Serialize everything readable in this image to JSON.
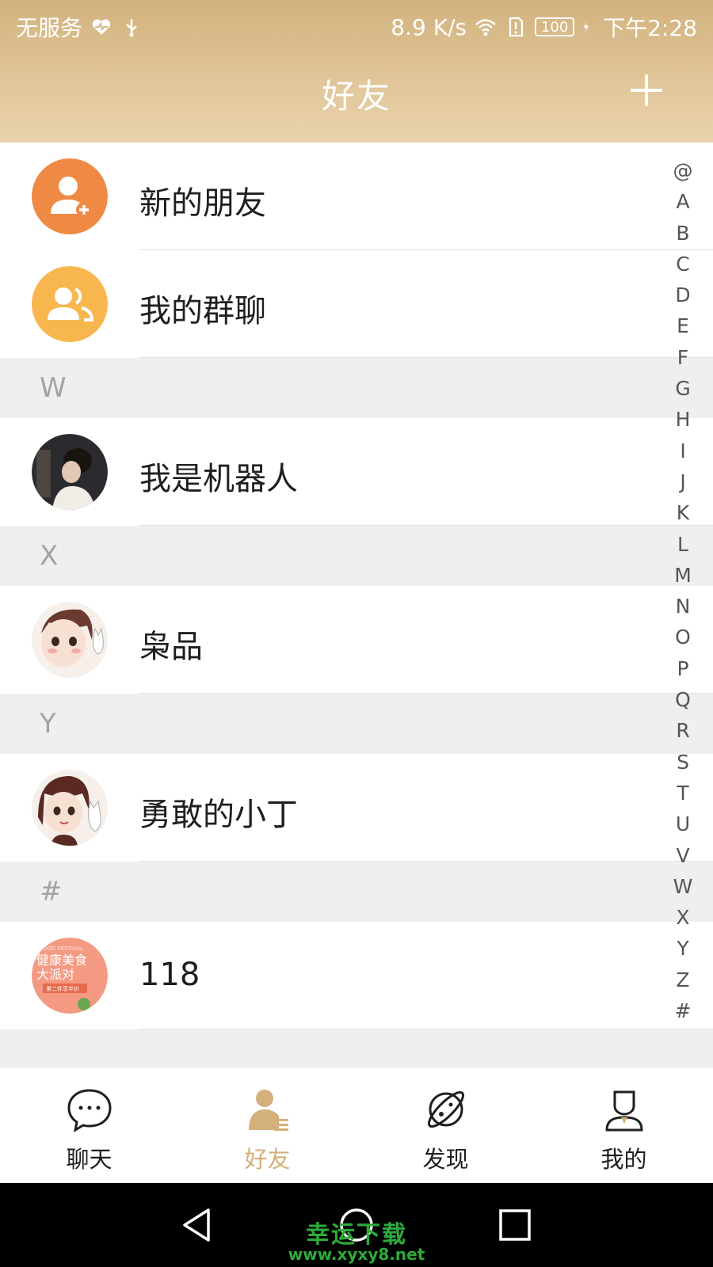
{
  "status_bar": {
    "carrier": "无服务",
    "speed": "8.9 K/s",
    "battery": "100",
    "time": "下午2:28"
  },
  "header": {
    "title": "好友"
  },
  "special_rows": [
    {
      "label": "新的朋友",
      "icon": "add-user-icon",
      "color": "#ef8a45"
    },
    {
      "label": "我的群聊",
      "icon": "group-icon",
      "color": "#f8b64f"
    }
  ],
  "sections": [
    {
      "letter": "W",
      "contacts": [
        {
          "name": "我是机器人"
        }
      ]
    },
    {
      "letter": "X",
      "contacts": [
        {
          "name": "枭品"
        }
      ]
    },
    {
      "letter": "Y",
      "contacts": [
        {
          "name": "勇敢的小丁"
        }
      ]
    },
    {
      "letter": "#",
      "contacts": [
        {
          "name": "118",
          "avatar_text": [
            "FOOD FESTIVAL",
            "健康美食",
            "大派对",
            "第二件享半价"
          ]
        }
      ]
    }
  ],
  "index_letters": [
    "@",
    "A",
    "B",
    "C",
    "D",
    "E",
    "F",
    "G",
    "H",
    "I",
    "J",
    "K",
    "L",
    "M",
    "N",
    "O",
    "P",
    "Q",
    "R",
    "S",
    "T",
    "U",
    "V",
    "W",
    "X",
    "Y",
    "Z",
    "#"
  ],
  "bottom_nav": [
    {
      "label": "聊天",
      "icon": "chat-bubble-icon",
      "active": false
    },
    {
      "label": "好友",
      "icon": "contacts-icon",
      "active": true
    },
    {
      "label": "发现",
      "icon": "planet-icon",
      "active": false
    },
    {
      "label": "我的",
      "icon": "profile-icon",
      "active": false
    }
  ],
  "watermark": {
    "text": "幸运下载",
    "url": "www.xyxy8.net"
  },
  "colors": {
    "header_gradient_top": "#d2b27e",
    "active_tab": "#d4b07b",
    "section_bg": "#efefef"
  }
}
